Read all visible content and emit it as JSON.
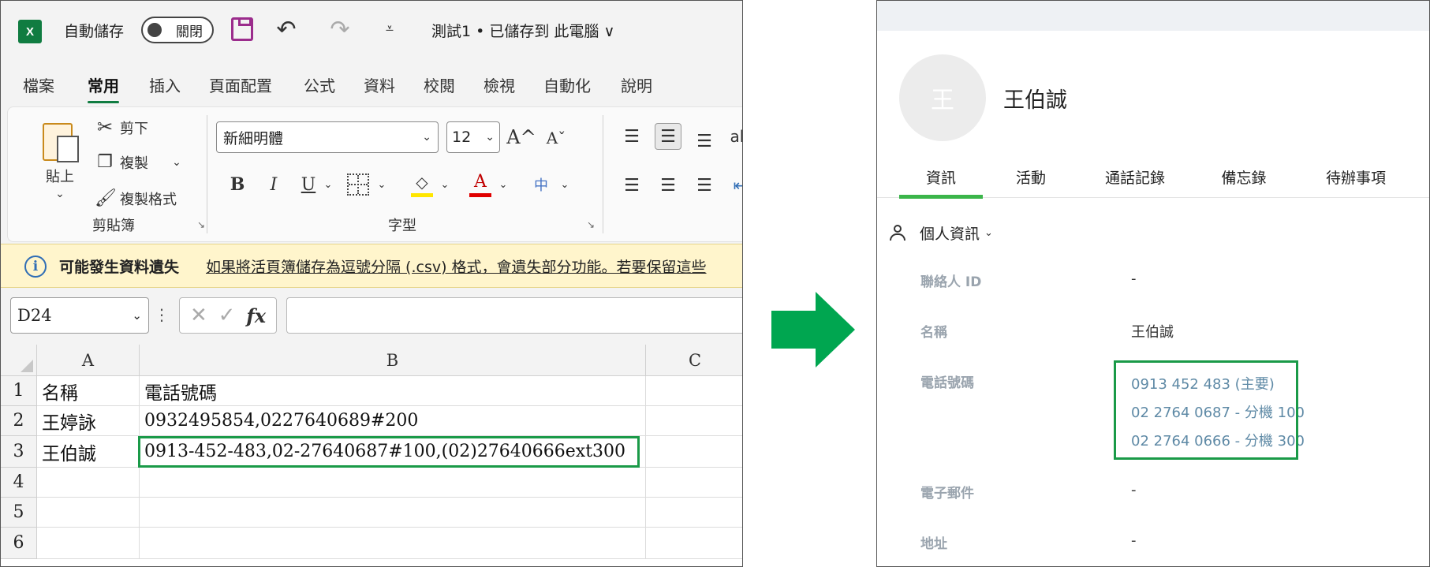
{
  "excel": {
    "app_logo": "X",
    "autosave_label": "自動儲存",
    "autosave_state": "關閉",
    "undo_icon": "↶",
    "redo_icon": "↷",
    "qat_more": "⩡",
    "doc_title": "測試1 • 已儲存到 此電腦 ∨",
    "menu_tabs": [
      "檔案",
      "常用",
      "插入",
      "頁面配置",
      "公式",
      "資料",
      "校閱",
      "檢視",
      "自動化",
      "說明"
    ],
    "active_tab": "常用",
    "clipboard": {
      "paste_label": "貼上",
      "cut_label": "剪下",
      "copy_label": "複製",
      "format_painter_label": "複製格式",
      "group_label": "剪貼簿"
    },
    "font": {
      "font_name": "新細明體",
      "font_size": "12",
      "grow_label": "A^",
      "shrink_label": "Aˇ",
      "bold": "B",
      "italic": "I",
      "underline": "U",
      "fill_icon": "◇",
      "font_color_icon": "A",
      "phonetic_icon": "中",
      "group_label": "字型"
    },
    "alignment": {
      "top": "☰",
      "middle": "☰",
      "bottom": "☰",
      "left": "☰",
      "center": "☰",
      "right": "☰",
      "orient": "ab",
      "indent": "⇤"
    },
    "infobar": {
      "icon": "i",
      "title": "可能發生資料遺失",
      "message": "如果將活頁簿儲存為逗號分隔 (.csv) 格式，會遺失部分功能。若要保留這些"
    },
    "formula_bar": {
      "name_box": "D24",
      "cancel": "✕",
      "enter": "✓",
      "fx": "fx",
      "value": ""
    },
    "columns": [
      "A",
      "B",
      "C"
    ],
    "rows": [
      "1",
      "2",
      "3",
      "4",
      "5",
      "6"
    ],
    "cells": {
      "A1": "名稱",
      "B1": "電話號碼",
      "A2": "王婷詠",
      "B2": "0932495854,0227640689#200",
      "A3": "王伯誠",
      "B3": "0913-452-483,02-27640687#100,(02)27640666ext300"
    },
    "colors": {
      "brand": "#107c41",
      "highlight": "#1a9a48"
    }
  },
  "crm": {
    "avatar_initial": "王",
    "contact_name": "王伯誠",
    "tabs": [
      "資訊",
      "活動",
      "通話記錄",
      "備忘錄",
      "待辦事項"
    ],
    "active_tab": "資訊",
    "section_title": "個人資訊",
    "section_chevron": "⌄",
    "fields": {
      "contact_id": {
        "label": "聯絡人 ID",
        "value": "-"
      },
      "name": {
        "label": "名稱",
        "value": "王伯誠"
      },
      "phone": {
        "label": "電話號碼",
        "values": [
          "0913 452 483 (主要)",
          "02 2764 0687 - 分機 100",
          "02 2764 0666 - 分機 300"
        ]
      },
      "email": {
        "label": "電子郵件",
        "value": "-"
      },
      "address": {
        "label": "地址",
        "value": "-"
      }
    },
    "colors": {
      "accent": "#3bb54a",
      "phone_link": "#5f8aa6",
      "highlight": "#1a9a48"
    }
  },
  "arrow": {
    "color": "#00a650"
  }
}
